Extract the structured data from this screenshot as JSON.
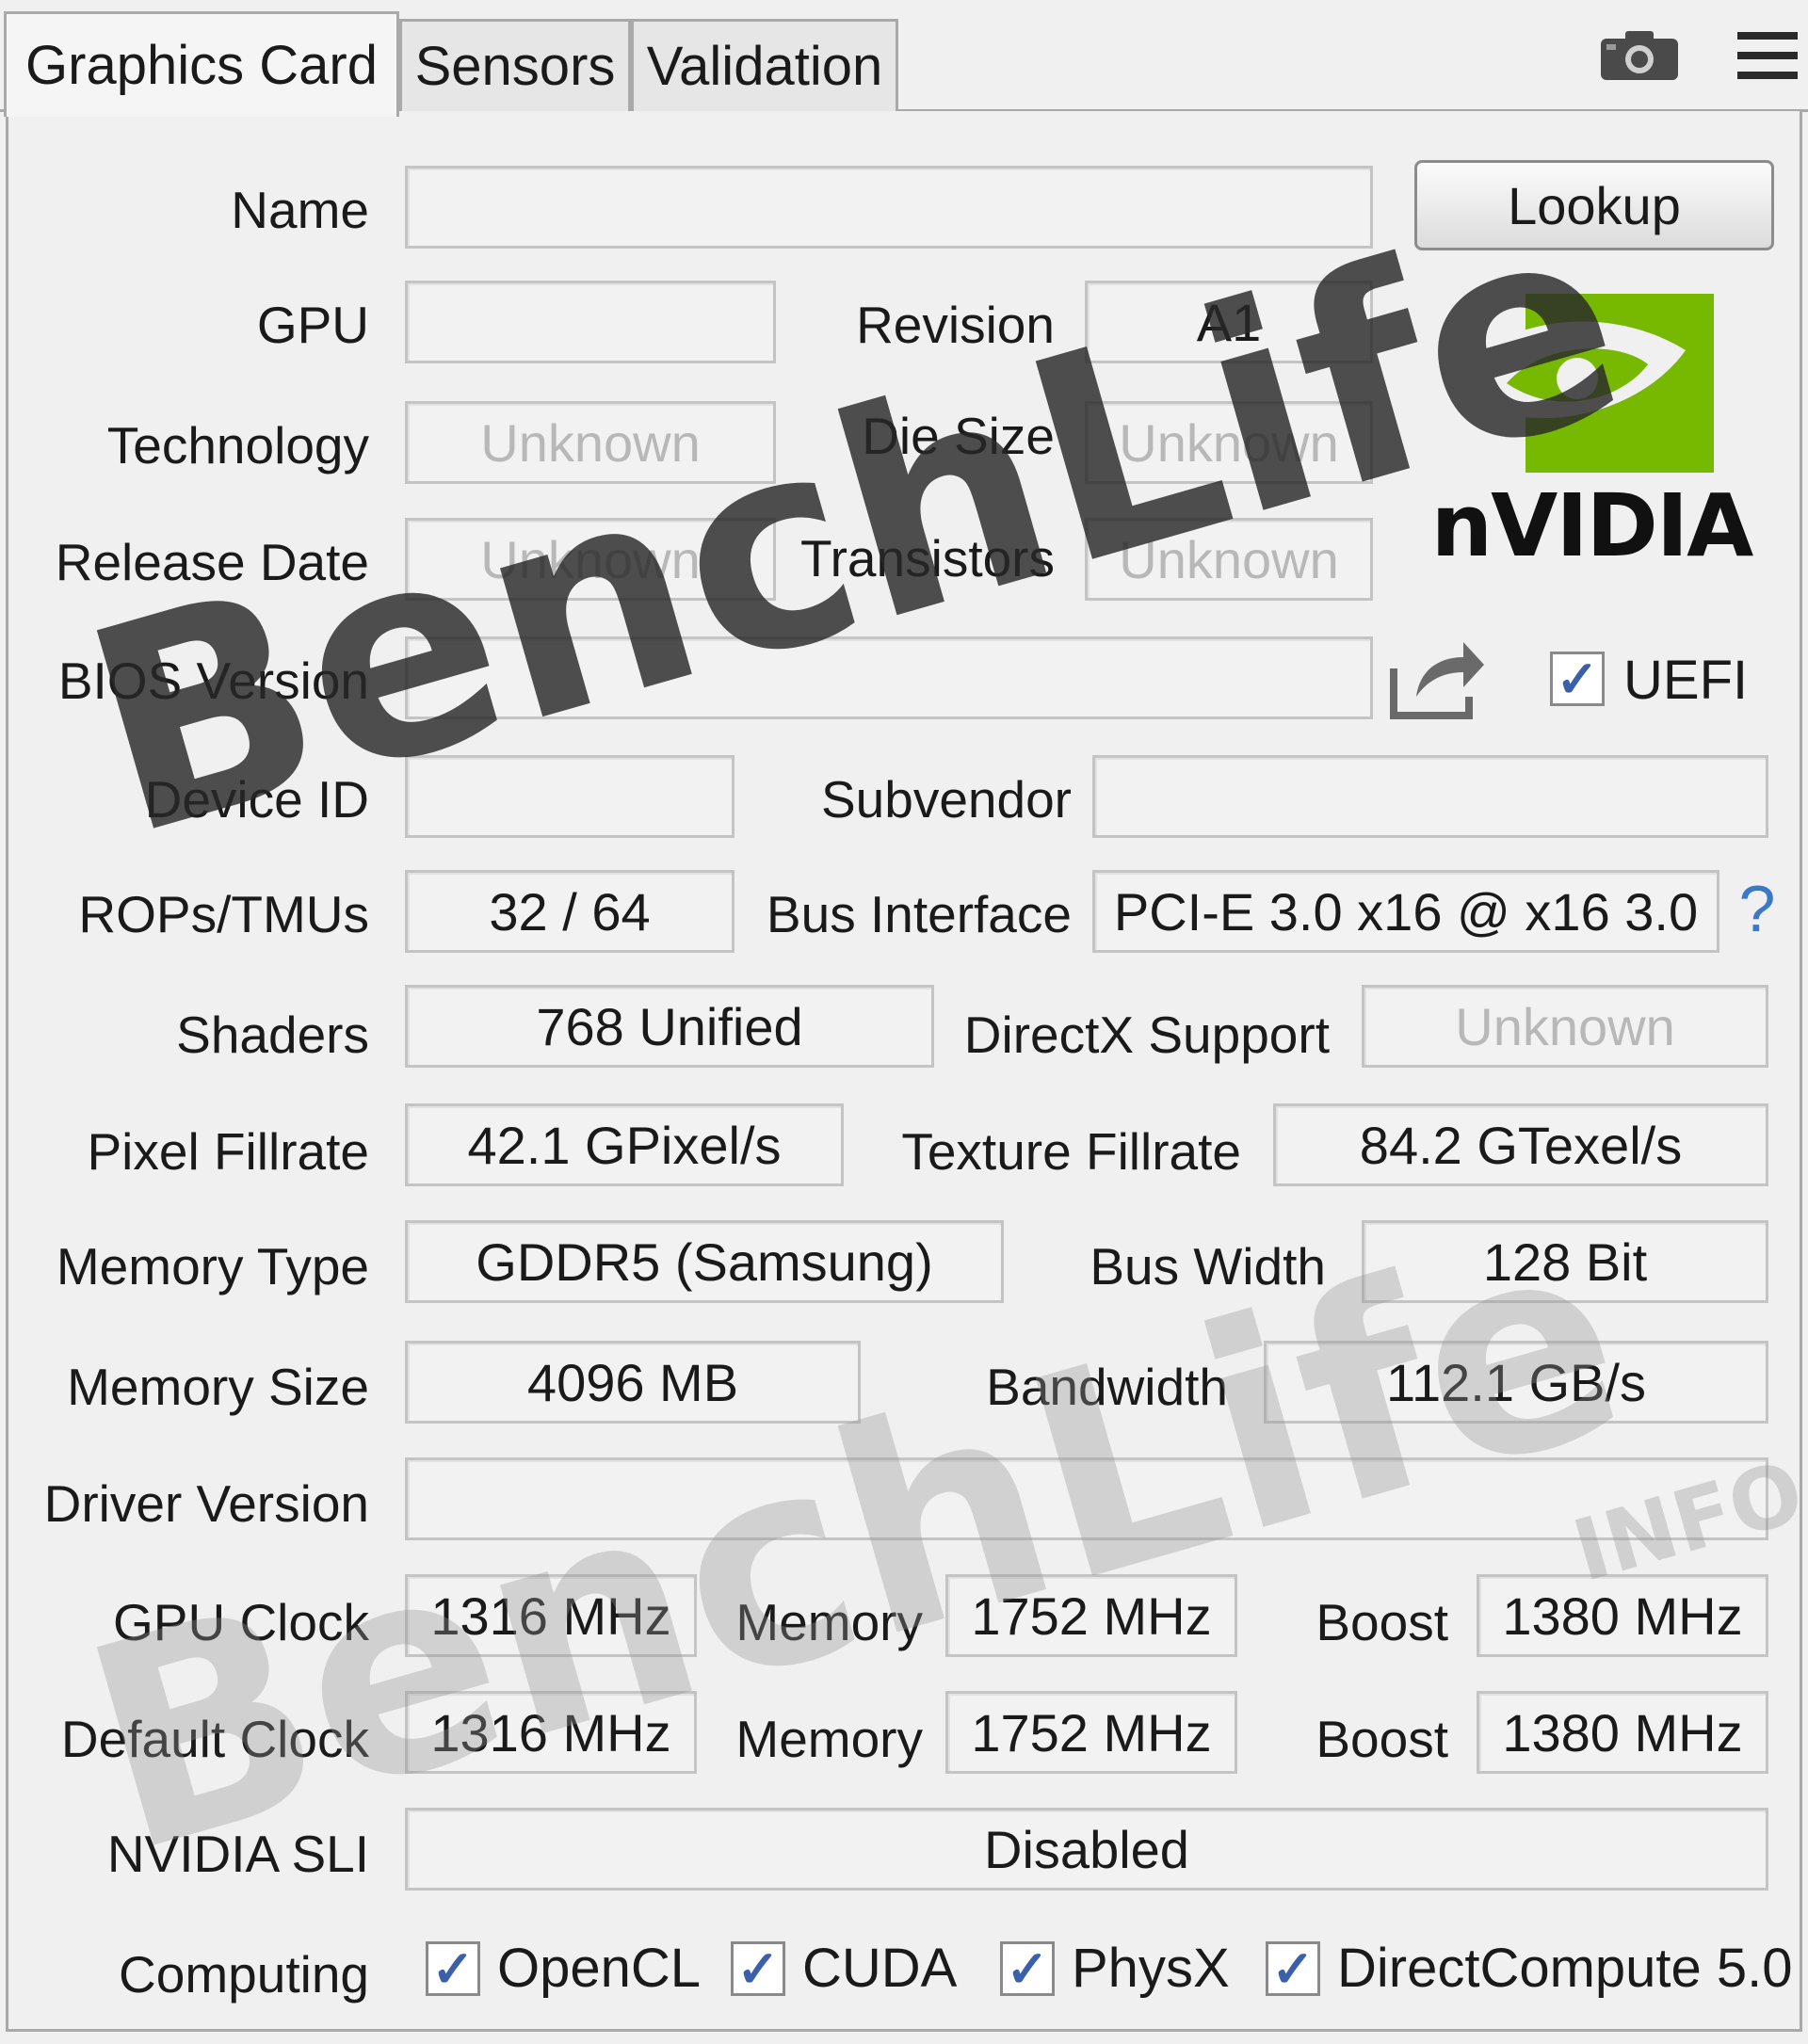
{
  "tabs": [
    {
      "label": "Graphics Card",
      "active": true
    },
    {
      "label": "Sensors",
      "active": false
    },
    {
      "label": "Validation",
      "active": false
    }
  ],
  "toolbar": {
    "camera_icon": "camera-icon",
    "menu_icon": "hamburger-menu-icon"
  },
  "lookup_button": "Lookup",
  "uefi": {
    "label": "UEFI",
    "checked": true
  },
  "help_glyph": "?",
  "labels": {
    "name": "Name",
    "gpu": "GPU",
    "revision": "Revision",
    "technology": "Technology",
    "die_size": "Die Size",
    "release_date": "Release Date",
    "transistors": "Transistors",
    "bios_version": "BIOS Version",
    "device_id": "Device ID",
    "subvendor": "Subvendor",
    "rops_tmus": "ROPs/TMUs",
    "bus_interface": "Bus Interface",
    "shaders": "Shaders",
    "directx": "DirectX Support",
    "pixel_fillrate": "Pixel Fillrate",
    "texture_fillrate": "Texture Fillrate",
    "memory_type": "Memory Type",
    "bus_width": "Bus Width",
    "memory_size": "Memory Size",
    "bandwidth": "Bandwidth",
    "driver_version": "Driver Version",
    "gpu_clock": "GPU Clock",
    "memory": "Memory",
    "boost": "Boost",
    "default_clock": "Default Clock",
    "nvidia_sli": "NVIDIA SLI",
    "computing": "Computing"
  },
  "values": {
    "name": "",
    "gpu": "",
    "revision": "A1",
    "technology": "Unknown",
    "die_size": "Unknown",
    "release_date": "Unknown",
    "transistors": "Unknown",
    "bios_version": "",
    "device_id": "",
    "subvendor": "",
    "rops_tmus": "32 / 64",
    "bus_interface": "PCI-E 3.0 x16 @ x16 3.0",
    "shaders": "768 Unified",
    "directx": "Unknown",
    "pixel_fillrate": "42.1 GPixel/s",
    "texture_fillrate": "84.2 GTexel/s",
    "memory_type": "GDDR5 (Samsung)",
    "bus_width": "128 Bit",
    "memory_size": "4096 MB",
    "bandwidth": "112.1 GB/s",
    "driver_version": "",
    "gpu_clock": "1316 MHz",
    "gpu_memory": "1752 MHz",
    "gpu_boost": "1380 MHz",
    "default_clock": "1316 MHz",
    "default_memory": "1752 MHz",
    "default_boost": "1380 MHz",
    "nvidia_sli": "Disabled"
  },
  "computing": [
    {
      "label": "OpenCL",
      "checked": true
    },
    {
      "label": "CUDA",
      "checked": true
    },
    {
      "label": "PhysX",
      "checked": true
    },
    {
      "label": "DirectCompute 5.0",
      "checked": true
    }
  ],
  "vendor_logo": {
    "text": "nVIDIA",
    "color": "#76b900"
  },
  "watermark": {
    "text": "BenchLife",
    "suffix": "INFO"
  },
  "colors": {
    "accent": "#76b900",
    "check": "#3b5fa8"
  }
}
